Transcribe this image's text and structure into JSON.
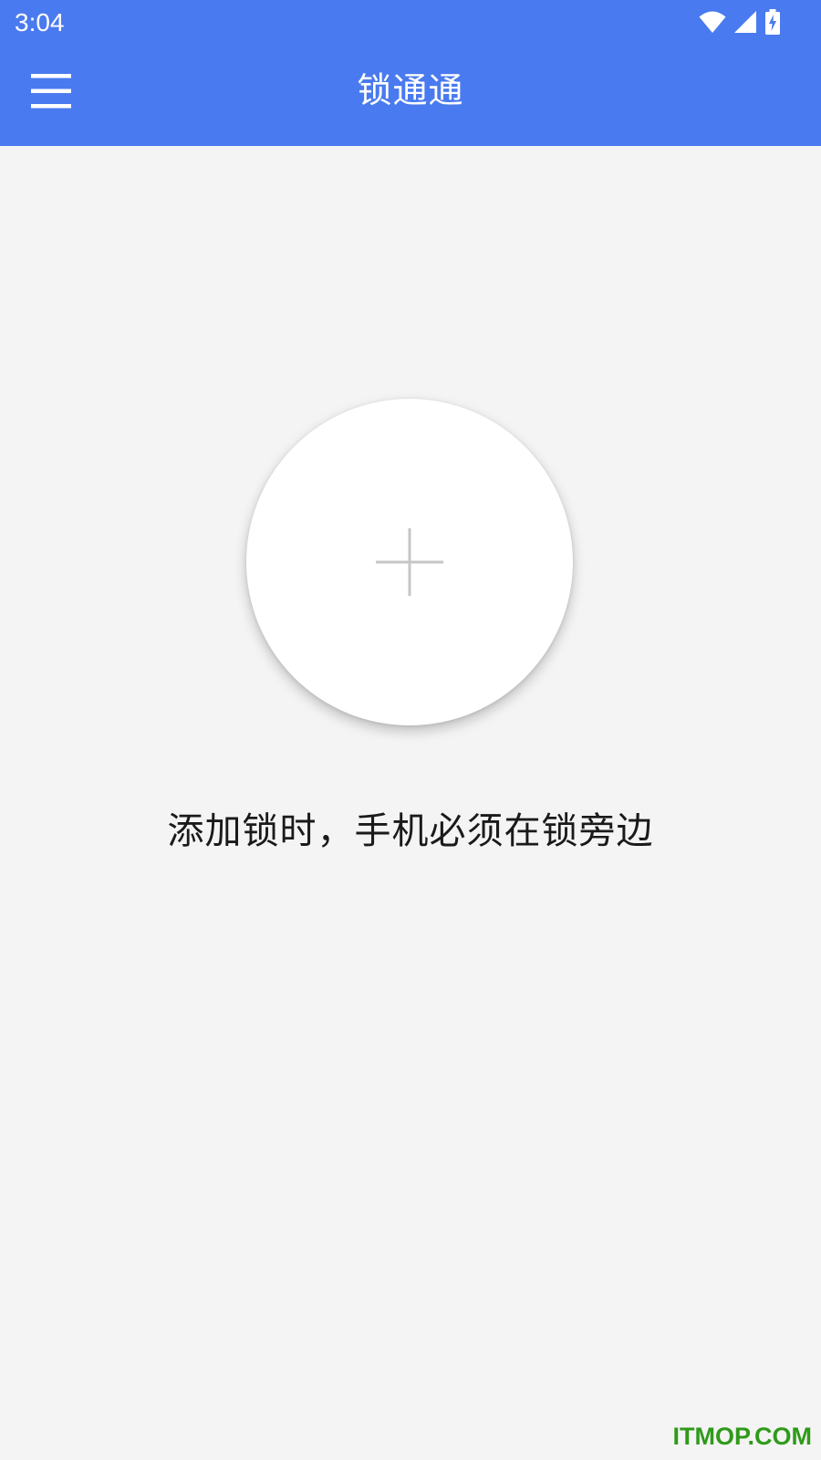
{
  "status_bar": {
    "time": "3:04",
    "icons": [
      "wifi-icon",
      "cell-signal-icon",
      "battery-charging-icon"
    ]
  },
  "toolbar": {
    "title": "锁通通",
    "menu_icon": "hamburger-menu-icon"
  },
  "main": {
    "add_icon": "plus-icon",
    "hint": "添加锁时，手机必须在锁旁边"
  },
  "watermark": {
    "text": "ITMOP.COM"
  },
  "colors": {
    "primary": "#4a7aef",
    "background": "#f4f4f4",
    "card": "#ffffff",
    "plus": "#c6c6c6",
    "text": "#1a1a1a",
    "watermark": "#2f9a1a"
  }
}
